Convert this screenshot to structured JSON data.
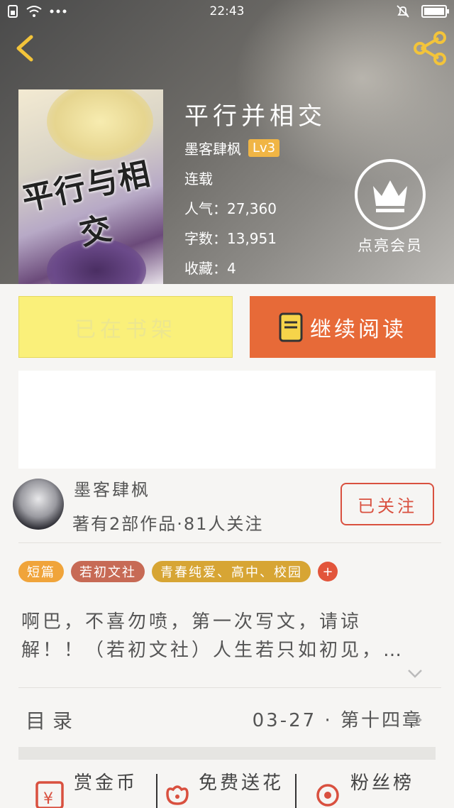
{
  "status_bar": {
    "time": "22:43"
  },
  "book": {
    "title": "平行并相交",
    "cover_text": "平行与相交",
    "author": "墨客肆枫",
    "level": "Lv3",
    "status": "连载",
    "popularity": "人气：27,360",
    "word_count": "字数：13,951",
    "favorites": "收藏：4"
  },
  "vip": {
    "label": "点亮会员"
  },
  "actions": {
    "on_shelf_label": "已在书架",
    "continue_label": "继续阅读"
  },
  "author_section": {
    "name": "墨客肆枫",
    "summary": "著有2部作品·81人关注",
    "follow_label": "已关注"
  },
  "tags": [
    {
      "label": "短篇",
      "color": "#f0a43a"
    },
    {
      "label": "若初文社",
      "color": "#c76a55"
    },
    {
      "label": "青春纯爱、高中、校园",
      "color": "#d7a534"
    }
  ],
  "tag_add": "+",
  "synopsis": {
    "line1": "啊巴，不喜勿喷，第一次写文，请谅",
    "line2": "解！！（若初文社）人生若只如初见，…"
  },
  "toc": {
    "label": "目录",
    "latest": "03-27 · 第十四章"
  },
  "bottom": {
    "reward": "赏金币",
    "flowers": "免费送花",
    "fans": "粉丝榜"
  },
  "colors": {
    "accent_orange": "#e76a38",
    "shelf_yellow": "#faf07a",
    "follow_red": "#d9503f"
  }
}
